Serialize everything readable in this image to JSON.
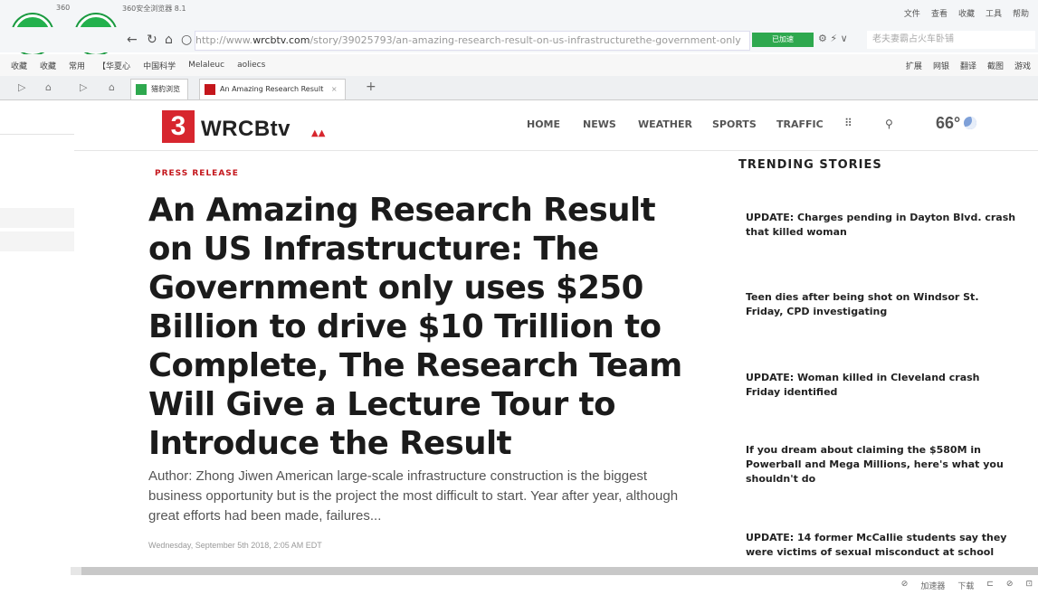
{
  "browser": {
    "app_name": "360安全浏览器 8.1",
    "corner_label": "360",
    "menu": [
      "文件",
      "查看",
      "收藏",
      "工具",
      "帮助"
    ],
    "url_prefix": "http://www.",
    "url_domain": "wrcbtv.com",
    "url_path": "/story/39025793/an-amazing-research-result-on-us-infrastructurethe-government-only",
    "url_badge": "已加速",
    "search_placeholder": "老夫妻霸占火车卧铺",
    "bookmarks": [
      "收藏",
      "收藏",
      "常用",
      "【华夏心",
      "中国科学",
      "Melaleuc",
      "aoliecs"
    ],
    "bookmarks_right": [
      "扩展",
      "网银",
      "翻译",
      "截图",
      "游戏"
    ],
    "tabs": [
      {
        "label": "猎豹浏览",
        "active": false
      },
      {
        "label": "An Amazing Research Result",
        "active": true
      }
    ]
  },
  "site": {
    "logo_number": "3",
    "logo_name": "WRCBtv",
    "nav": [
      "HOME",
      "NEWS",
      "WEATHER",
      "SPORTS",
      "TRAFFIC"
    ],
    "temperature": "66°"
  },
  "article": {
    "kicker": "PRESS RELEASE",
    "headline": "An Amazing Research Result on US Infrastructure: The Government only uses $250 Billion to drive $10 Trillion to Complete, The Research Team Will Give a Lecture Tour to Introduce the Result",
    "summary": "Author: Zhong Jiwen  American large-scale infrastructure construction is the biggest business opportunity but is the project the most difficult to start. Year after year, although great efforts had been made, failures...",
    "date": "Wednesday, September 5th 2018, 2:05 AM EDT"
  },
  "trending": {
    "title": "TRENDING STORIES",
    "items": [
      "UPDATE: Charges pending in Dayton Blvd. crash that killed woman",
      "Teen dies after being shot on Windsor St. Friday, CPD investigating",
      "UPDATE: Woman killed in Cleveland crash Friday identified",
      "If you dream about claiming the $580M in Powerball and Mega Millions, here's what you shouldn't do",
      "UPDATE: 14 former McCallie students say they were victims of sexual misconduct at school"
    ]
  },
  "statusbar": {
    "items": [
      "加速器",
      "下载"
    ]
  }
}
